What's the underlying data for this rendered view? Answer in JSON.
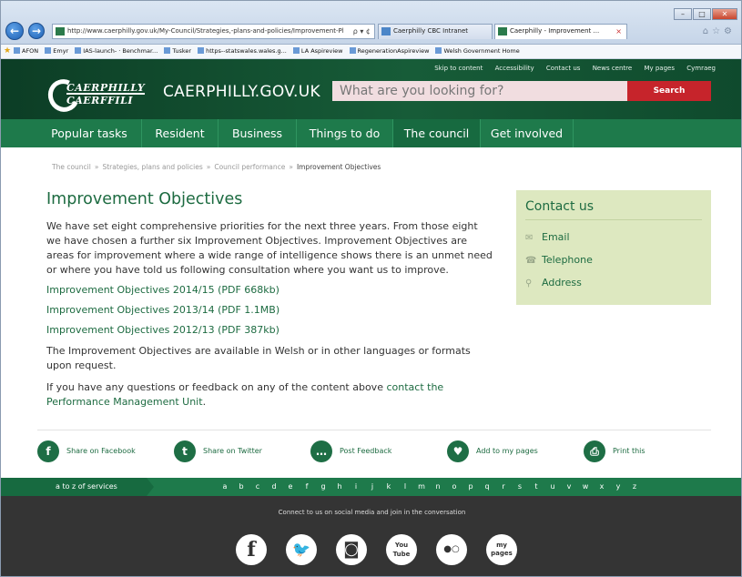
{
  "browser": {
    "address": "http://www.caerphilly.gov.uk/My-Council/Strategies,-plans-and-policies/Improvement-Pl",
    "address_domain": "caerphilly.gov.uk",
    "address_tools": "ρ ▾ ¢",
    "tabs": [
      {
        "label": "Caerphilly CBC Intranet"
      },
      {
        "label": "Caerphilly - Improvement ...",
        "close": "×"
      }
    ],
    "favorites": [
      "AFON",
      "Emyr",
      "IAS-launch- · Benchmar...",
      "Tusker",
      "https--statswales.wales.g...",
      "LA Aspireview",
      "RegenerationAspireview",
      "Welsh Government Home"
    ]
  },
  "header": {
    "toplinks": [
      "Skip to content",
      "Accessibility",
      "Contact us",
      "News centre",
      "My pages",
      "Cymraeg"
    ],
    "logo_line1": "CAERPHILLY",
    "logo_line2": "CAERFFILI",
    "site_name": "CAERPHILLY.GOV.UK",
    "search_placeholder": "What are you looking for?",
    "search_button": "Search"
  },
  "nav": [
    {
      "label": "Popular tasks"
    },
    {
      "label": "Resident"
    },
    {
      "label": "Business"
    },
    {
      "label": "Things to do"
    },
    {
      "label": "The council",
      "active": true
    },
    {
      "label": "Get involved"
    }
  ],
  "breadcrumb": {
    "items": [
      "The council",
      "Strategies, plans and policies",
      "Council performance"
    ],
    "separator": "»",
    "current": "Improvement Objectives"
  },
  "content": {
    "title": "Improvement Objectives",
    "intro": "We have set eight comprehensive priorities for the next three years. From those eight we have chosen a further six Improvement Objectives. Improvement Objectives are areas for improvement where a wide range of intelligence shows there is an unmet need or where you have told us following consultation where you want us to improve.",
    "links": [
      "Improvement Objectives 2014/15 (PDF 668kb)",
      "Improvement Objectives 2013/14 (PDF 1.1MB)",
      "Improvement Objectives 2012/13 (PDF 387kb)"
    ],
    "formats_text": "The Improvement Objectives are available in Welsh or in other languages or formats upon request.",
    "feedback_text": "If you have any questions or feedback on any of the content above ",
    "feedback_link": "contact the Performance Management Unit",
    "feedback_end": "."
  },
  "contact": {
    "title": "Contact us",
    "items": [
      "Email",
      "Telephone",
      "Address"
    ]
  },
  "share": [
    {
      "label": "Share on Facebook",
      "icon": "f"
    },
    {
      "label": "Share on Twitter",
      "icon": "t"
    },
    {
      "label": "Post Feedback",
      "icon": "…"
    },
    {
      "label": "Add to my pages",
      "icon": "♥"
    },
    {
      "label": "Print this",
      "icon": "⎙"
    }
  ],
  "az": {
    "label": "a to z of services",
    "letters": [
      "a",
      "b",
      "c",
      "d",
      "e",
      "f",
      "g",
      "h",
      "i",
      "j",
      "k",
      "l",
      "m",
      "n",
      "o",
      "p",
      "q",
      "r",
      "s",
      "t",
      "u",
      "v",
      "w",
      "x",
      "y",
      "z"
    ]
  },
  "footer": {
    "text": "Connect to us on social media and join in the conversation",
    "social": [
      {
        "name": "facebook-icon",
        "glyph": "f"
      },
      {
        "name": "twitter-icon",
        "glyph": "🐦"
      },
      {
        "name": "instagram-icon",
        "glyph": "◙"
      },
      {
        "name": "youtube-icon",
        "glyph": "You Tube"
      },
      {
        "name": "flickr-icon",
        "glyph": "●○"
      },
      {
        "name": "my-pages-icon",
        "glyph": "my pages"
      }
    ]
  },
  "colors": {
    "brand_green": "#1e7a4b",
    "dark_green": "#0f4a2d",
    "search_red": "#c6242b",
    "contact_bg": "#dde8c0"
  }
}
